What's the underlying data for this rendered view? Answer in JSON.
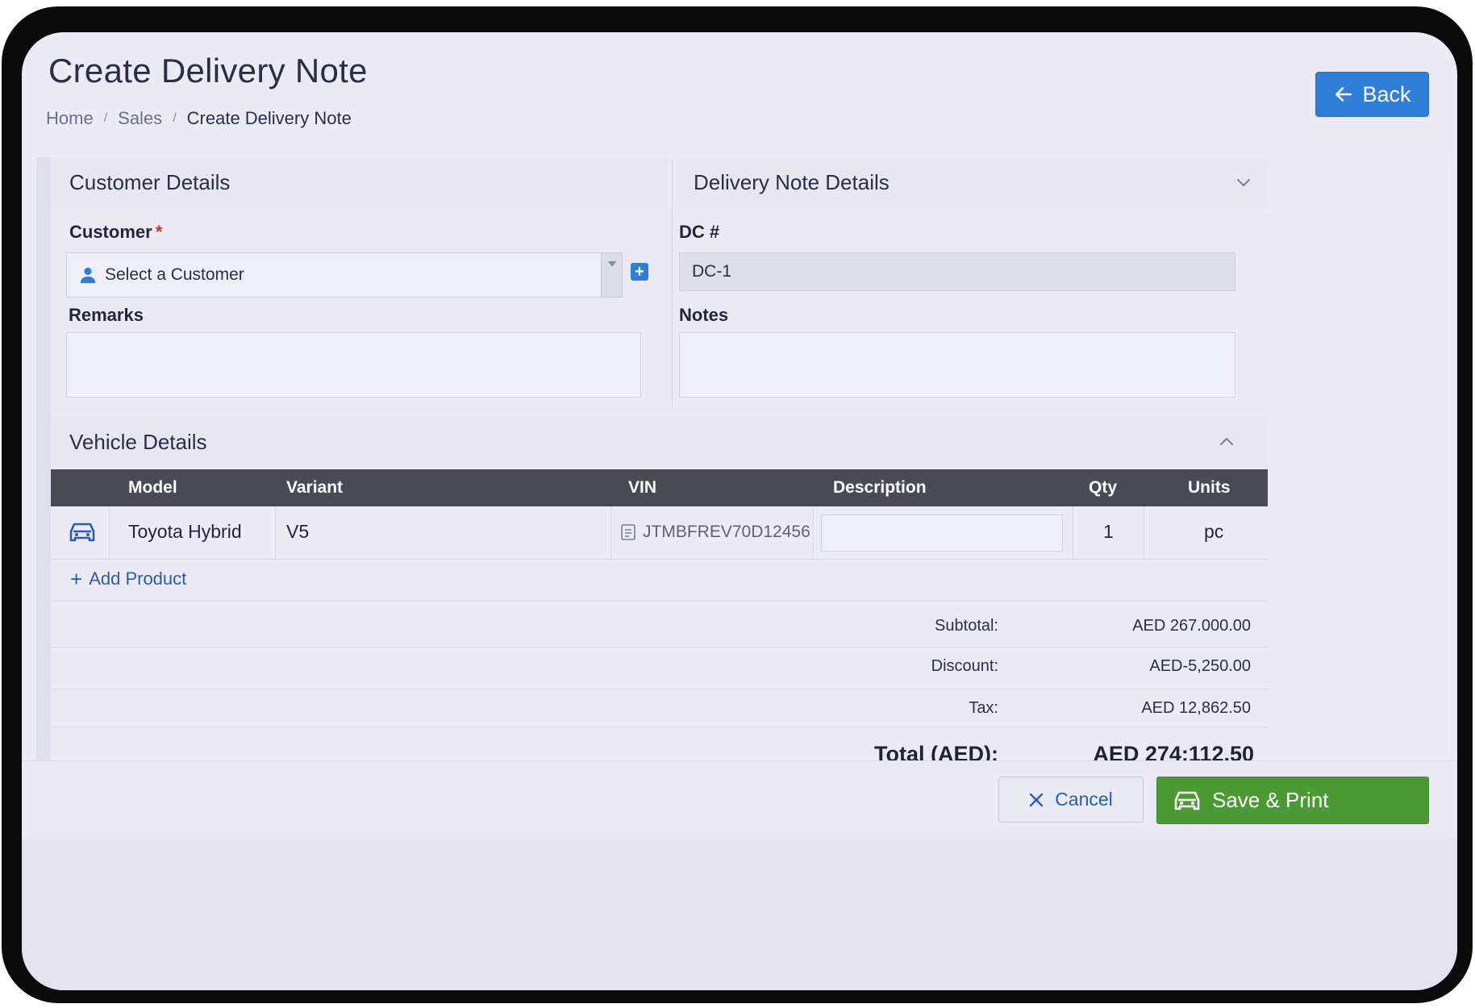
{
  "header": {
    "title": "Create Delivery Note",
    "breadcrumb": [
      "Home",
      "Sales",
      "Create Delivery Note"
    ],
    "back_label": "Back"
  },
  "customer_section": {
    "title": "Customer Details",
    "customer_label": "Customer",
    "required_marker": "*",
    "customer_placeholder": "Select a Customer",
    "remarks_label": "Remarks"
  },
  "delivery_section": {
    "title": "Delivery Note Details",
    "dc_label": "DC #",
    "dc_value": "DC-1",
    "notes_label": "Notes"
  },
  "vehicle_section": {
    "title": "Vehicle Details",
    "columns": [
      "Model",
      "Variant",
      "VIN",
      "Description",
      "Qty",
      "Units"
    ],
    "rows": [
      {
        "icon": "car-icon",
        "model": "Toyota Hybrid",
        "variant": "V5",
        "vin": "JTMBFREV70D12456",
        "description": "",
        "qty": "1",
        "units": "pc"
      }
    ],
    "add_product_label": "Add Product"
  },
  "summary": {
    "subtotal_label": "Subtotal:",
    "subtotal_value": "AED 267.000.00",
    "discount_label": "Discount:",
    "discount_value": "AED-5,250.00",
    "tax_label": "Tax:",
    "tax_value": "AED 12,862.50",
    "total_label": "Total (AED):",
    "total_value": "AED 274;112.50"
  },
  "footer": {
    "cancel_label": "Cancel",
    "save_label": "Save & Print"
  },
  "colors": {
    "primary": "#2f7fd6",
    "success": "#4b9a34",
    "table_header": "#4a4a52",
    "background": "#ecebf5"
  }
}
